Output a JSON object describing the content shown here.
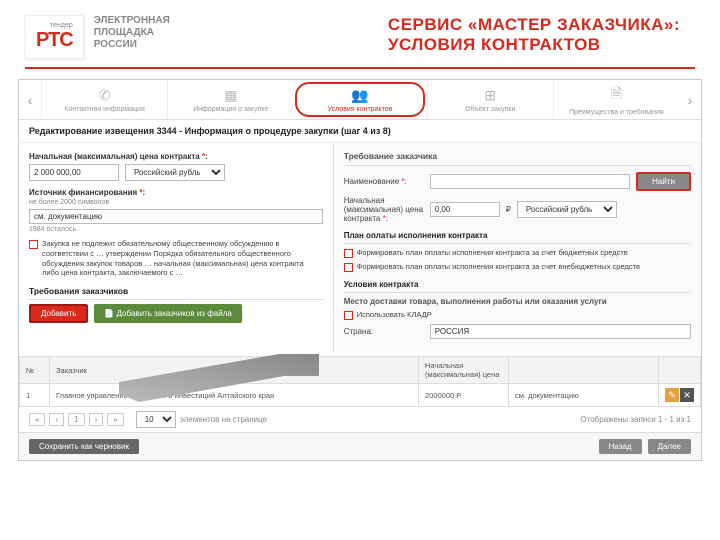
{
  "header": {
    "logo_tender": "тендер",
    "logo_rtc": "РТС",
    "logo_sub1": "ЭЛЕКТРОННАЯ",
    "logo_sub2": "ПЛОЩАДКА",
    "logo_sub3": "РОССИИ",
    "title1": "СЕРВИС «МАСТЕР ЗАКАЗЧИКА»:",
    "title2": "УСЛОВИЯ КОНТРАКТОВ"
  },
  "tabs": {
    "prev": "‹",
    "next": "›",
    "items": [
      {
        "icon": "✆",
        "label": "Контактная информация"
      },
      {
        "icon": "▦",
        "label": "Информация о закупке"
      },
      {
        "icon": "👥",
        "label": "Условия контрактов"
      },
      {
        "icon": "⊞",
        "label": "Объект закупки"
      },
      {
        "icon": "🗎",
        "label": "Преимущества и требования"
      }
    ],
    "active_index": 2
  },
  "subheader": "Редактирование извещения 3344 - Информация о процедуре закупки (шаг 4 из 8)",
  "left": {
    "price_label": "Начальная (максимальная) цена контракта",
    "price_value": "2 000 000,00",
    "currency_value": "Российский рубль",
    "source_label": "Источник финансирования",
    "source_note": "не более 2000 символов",
    "source_value": "см. документацию",
    "remaining": "1984 осталось",
    "discussion_text": "Закупка не подлежит обязательному общественному обсуждению в соответствии с … утверждении Порядка обязательного общественного обсуждения закупок товаров … начальная (максимальная) цена контракта либо цена контракта, заключаемого с …",
    "req_title": "Требования заказчиков",
    "btn_add": "Добавить",
    "btn_add_file": "Добавить заказчиков из файла",
    "table": {
      "cols": [
        "№",
        "Заказчик",
        "Начальная (максимальная) цена",
        "",
        ""
      ],
      "row": {
        "n": "1",
        "customer": "Главное управление экономики и инвестиций Алтайского края",
        "price": "2000000 Р",
        "doc": "см. документацию"
      }
    }
  },
  "right": {
    "header": "Требование заказчика",
    "name_label": "Наименование",
    "btn_find": "Найти",
    "price_label": "Начальная (максимальная) цена контракта",
    "price_value": "0,00",
    "currency_value": "Российский рубль",
    "plan_title": "План оплаты исполнения контракта",
    "plan_cb1": "Формировать план оплаты исполнения контракта за счет бюджетных средств",
    "plan_cb2": "Формировать план оплаты исполнения контракта за счет внебюджетных средств",
    "cond_title": "Условия контракта",
    "delivery_label": "Место доставки товара, выполнения работы или оказания услуги",
    "kladr": "Использовать КЛАДР",
    "country_label": "Страна:",
    "country_value": "РОССИЯ"
  },
  "pager": {
    "first": "«",
    "prev": "‹",
    "page": "1",
    "next": "›",
    "last": "»",
    "per_page": "10",
    "per_label": "элементов на странице",
    "status": "Отображены записи 1 - 1 из 1"
  },
  "footer": {
    "draft": "Сохранить как черновик",
    "back": "Назад",
    "next": "Далее"
  }
}
